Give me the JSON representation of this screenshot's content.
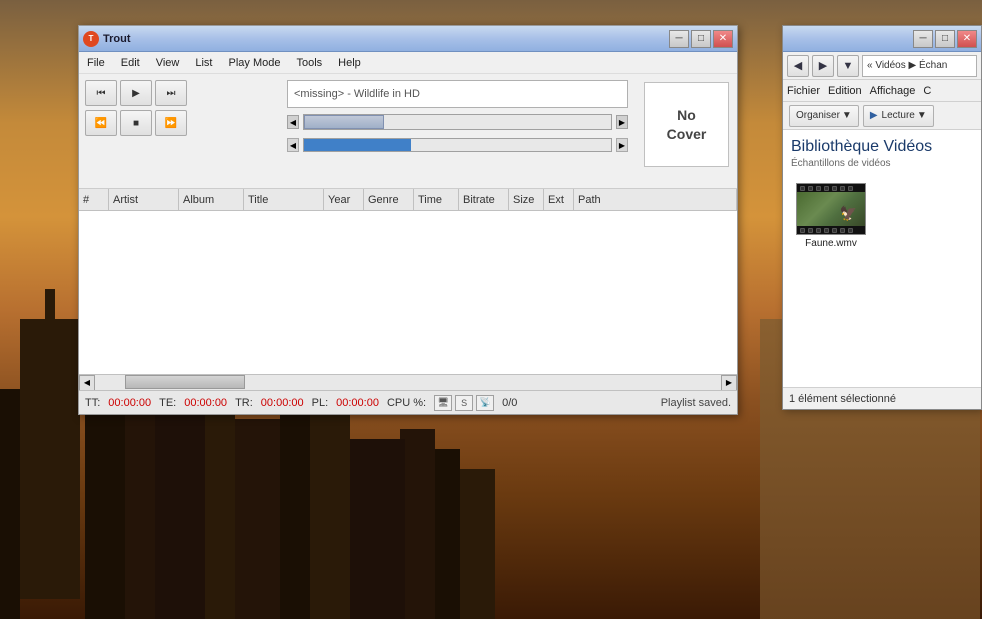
{
  "desktop": {
    "background": "NYC skyline warm amber tones"
  },
  "trout_window": {
    "title": "Trout",
    "min_label": "─",
    "max_label": "□",
    "close_label": "✕",
    "menu": {
      "items": [
        "File",
        "Edit",
        "View",
        "List",
        "Play Mode",
        "Tools",
        "Help"
      ]
    },
    "track_display": "<missing> - Wildlife in HD",
    "cover_art": {
      "line1": "No",
      "line2": "Cover"
    },
    "player_buttons": {
      "prev": "⏮",
      "play": "▶",
      "next": "⏭",
      "rewind": "⏪",
      "stop": "■",
      "forward": "⏩"
    },
    "playlist": {
      "columns": [
        "#",
        "Artist",
        "Album",
        "Title",
        "Year",
        "Genre",
        "Time",
        "Bitrate",
        "Size",
        "Ext",
        "Path"
      ],
      "rows": []
    },
    "status": {
      "tt_label": "TT:",
      "tt_value": "00:00:00",
      "te_label": "TE:",
      "te_value": "00:00:00",
      "tr_label": "TR:",
      "tr_value": "00:00:00",
      "pl_label": "PL:",
      "pl_value": "00:00:00",
      "cpu_label": "CPU %:",
      "count": "0/0",
      "message": "Playlist saved.",
      "icons": [
        "🖥",
        "S",
        "📡"
      ]
    }
  },
  "explorer_window": {
    "title": "",
    "nav_back": "◀",
    "nav_forward": "▶",
    "nav_dropdown": "▼",
    "breadcrumb": "« Vidéos ▶ Échan",
    "menu_items": [
      "Fichier",
      "Edition",
      "Affichage",
      "C"
    ],
    "toolbar": {
      "organize": "Organiser",
      "lecture": "Lecture"
    },
    "heading": "Bibliothèque Vidéos",
    "subheading": "Échantillons de vidéos",
    "files": [
      {
        "name": "Faune.wmv"
      }
    ],
    "status": "1 élément sélectionné"
  }
}
